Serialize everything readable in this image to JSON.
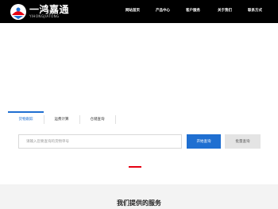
{
  "brand": {
    "name": "一鸿嘉通",
    "sub": "YIHONGJIATONG",
    "icon": "logo-mark-icon"
  },
  "nav": {
    "items": [
      {
        "label": "网站首页"
      },
      {
        "label": "产品中心"
      },
      {
        "label": "客户服务"
      },
      {
        "label": "关于我们"
      },
      {
        "label": "联系方式"
      }
    ]
  },
  "tabs": [
    {
      "label": "货物跟踪",
      "active": true
    },
    {
      "label": "运费计算",
      "active": false
    },
    {
      "label": "仓储查询",
      "active": false
    }
  ],
  "search": {
    "value": "",
    "placeholder": "请输入您要查询的货物单号",
    "query_label": "开始查询",
    "multi_label": "批量查询"
  },
  "colors": {
    "header_bg": "#000000",
    "accent_blue": "#1f6fd1",
    "accent_red": "#e60012",
    "section_bg": "#f3f3f3"
  },
  "services": {
    "title": "我们提供的服务"
  }
}
